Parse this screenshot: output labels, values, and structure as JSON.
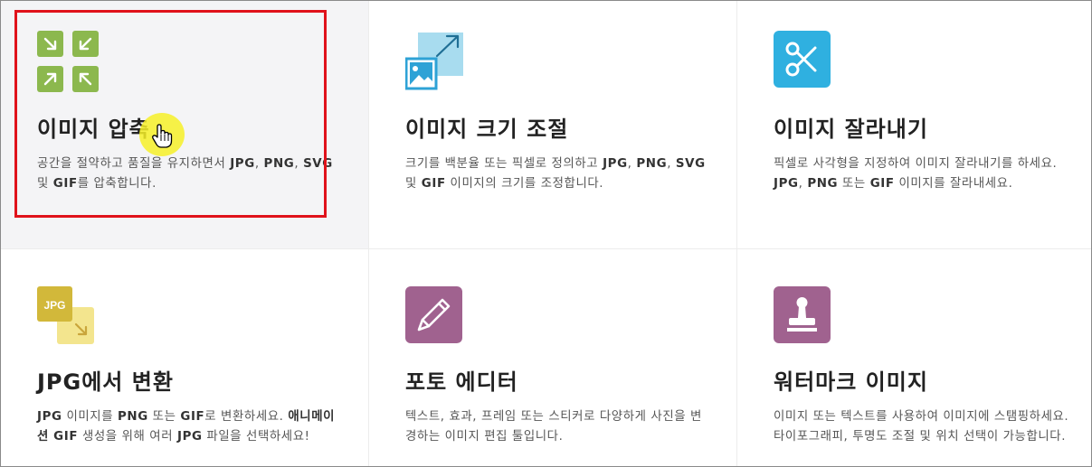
{
  "cards": [
    {
      "title": "이미지 압축",
      "desc_parts": [
        "공간을 절약하고 품질을 유지하면서 ",
        "JPG",
        ", ",
        "PNG",
        ", ",
        "SVG",
        " 및 ",
        "GIF",
        "를 압축합니다."
      ],
      "icon": "compress-arrows-icon",
      "accent": "#8cb84e",
      "highlighted": true
    },
    {
      "title": "이미지 크기 조절",
      "desc_parts": [
        "크기를 백분율 또는 픽셀로 정의하고 ",
        "JPG",
        ", ",
        "PNG",
        ", ",
        "SVG",
        " 및 ",
        "GIF",
        " 이미지의 크기를 조정합니다."
      ],
      "icon": "resize-image-icon",
      "accent": "#2ea2d6"
    },
    {
      "title": "이미지 잘라내기",
      "desc_parts": [
        "픽셀로 사각형을 지정하여 이미지 잘라내기를 하세요. ",
        "JPG",
        ", ",
        "PNG",
        " 또는 ",
        "GIF",
        " 이미지를 잘라내세요."
      ],
      "icon": "scissors-icon",
      "accent": "#2fb0e0"
    },
    {
      "title": "JPG에서 변환",
      "desc_parts": [
        "JPG",
        " 이미지를 ",
        "PNG",
        " 또는 ",
        "GIF",
        "로 변환하세요. ",
        "애니메이션 GIF",
        " 생성을 위해 여러 ",
        "JPG",
        " 파일을 선택하세요!"
      ],
      "icon": "jpg-convert-icon",
      "icon_label": "JPG",
      "accent": "#d2b83a"
    },
    {
      "title": "포토 에디터",
      "desc_parts": [
        "텍스트, 효과, 프레임 또는 스티커로 다양하게 사진을 변경하는 이미지 편집 툴입니다."
      ],
      "icon": "pencil-icon",
      "accent": "#a0628f"
    },
    {
      "title": "워터마크 이미지",
      "desc_parts": [
        "이미지 또는 텍스트를 사용하여 이미지에 스탬핑하세요. 타이포그래피, 투명도 조절 및 위치 선택이 가능합니다."
      ],
      "icon": "stamp-icon",
      "accent": "#a0628f"
    }
  ],
  "colors": {
    "highlight_frame": "#e0121b",
    "cursor_halo": "#f6f028",
    "hover_bg": "#f4f4f6"
  }
}
